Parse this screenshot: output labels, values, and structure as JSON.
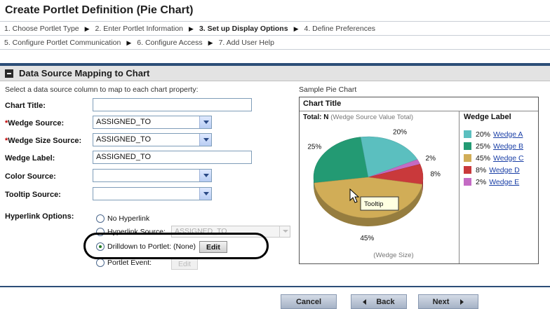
{
  "page": {
    "title": "Create Portlet Definition (Pie Chart)"
  },
  "steps": {
    "row1": [
      "1. Choose Portlet Type",
      "2. Enter Portlet Information",
      "3. Set up Display Options",
      "4. Define Preferences"
    ],
    "row2": [
      "5. Configure Portlet Communication",
      "6. Configure Access",
      "7. Add User Help"
    ],
    "current_index": 2
  },
  "section": {
    "title": "Data Source Mapping to Chart",
    "instruction": "Select a data source column to map to each chart property:",
    "sample_label": "Sample Pie Chart"
  },
  "form": {
    "chart_title": {
      "label": "Chart Title:",
      "value": ""
    },
    "wedge_source": {
      "label": "Wedge Source:",
      "value": "ASSIGNED_TO"
    },
    "wedge_size_source": {
      "label": "Wedge Size Source:",
      "value": "ASSIGNED_TO"
    },
    "wedge_label": {
      "label": "Wedge Label:",
      "value": "ASSIGNED_TO"
    },
    "color_source": {
      "label": "Color Source:",
      "value": ""
    },
    "tooltip_source": {
      "label": "Tooltip Source:",
      "value": ""
    },
    "required_marker": "*",
    "hyperlink": {
      "label": "Hyperlink Options:",
      "options": [
        {
          "label": "No Hyperlink",
          "selected": false
        },
        {
          "label": "Hyperlink Source:",
          "selected": false,
          "select_value": "ASSIGNED_TO"
        },
        {
          "label": "Drilldown to Portlet: (None)",
          "selected": true,
          "button": "Edit"
        },
        {
          "label": "Portlet Event:",
          "selected": false,
          "button": "Edit"
        }
      ]
    }
  },
  "chart": {
    "title": "Chart Title",
    "total_label": "Total: N",
    "total_hint": "(Wedge Source Value Total)",
    "legend_header": "Wedge Label",
    "tooltip_text": "Tooltip",
    "size_caption": "(Wedge Size)"
  },
  "chart_data": {
    "type": "pie",
    "title": "Chart Title",
    "slices": [
      {
        "label": "Wedge A",
        "value": 20,
        "pct_label": "20%",
        "color": "#5bbfbf"
      },
      {
        "label": "Wedge B",
        "value": 25,
        "pct_label": "25%",
        "color": "#239a73"
      },
      {
        "label": "Wedge C",
        "value": 45,
        "pct_label": "45%",
        "color": "#d1ad57"
      },
      {
        "label": "Wedge D",
        "value": 8,
        "pct_label": "8%",
        "color": "#c9393b"
      },
      {
        "label": "Wedge E",
        "value": 2,
        "pct_label": "2%",
        "color": "#c46bc4"
      }
    ],
    "legend_placement": "right"
  },
  "nav": {
    "cancel": "Cancel",
    "back": "Back",
    "next": "Next"
  }
}
